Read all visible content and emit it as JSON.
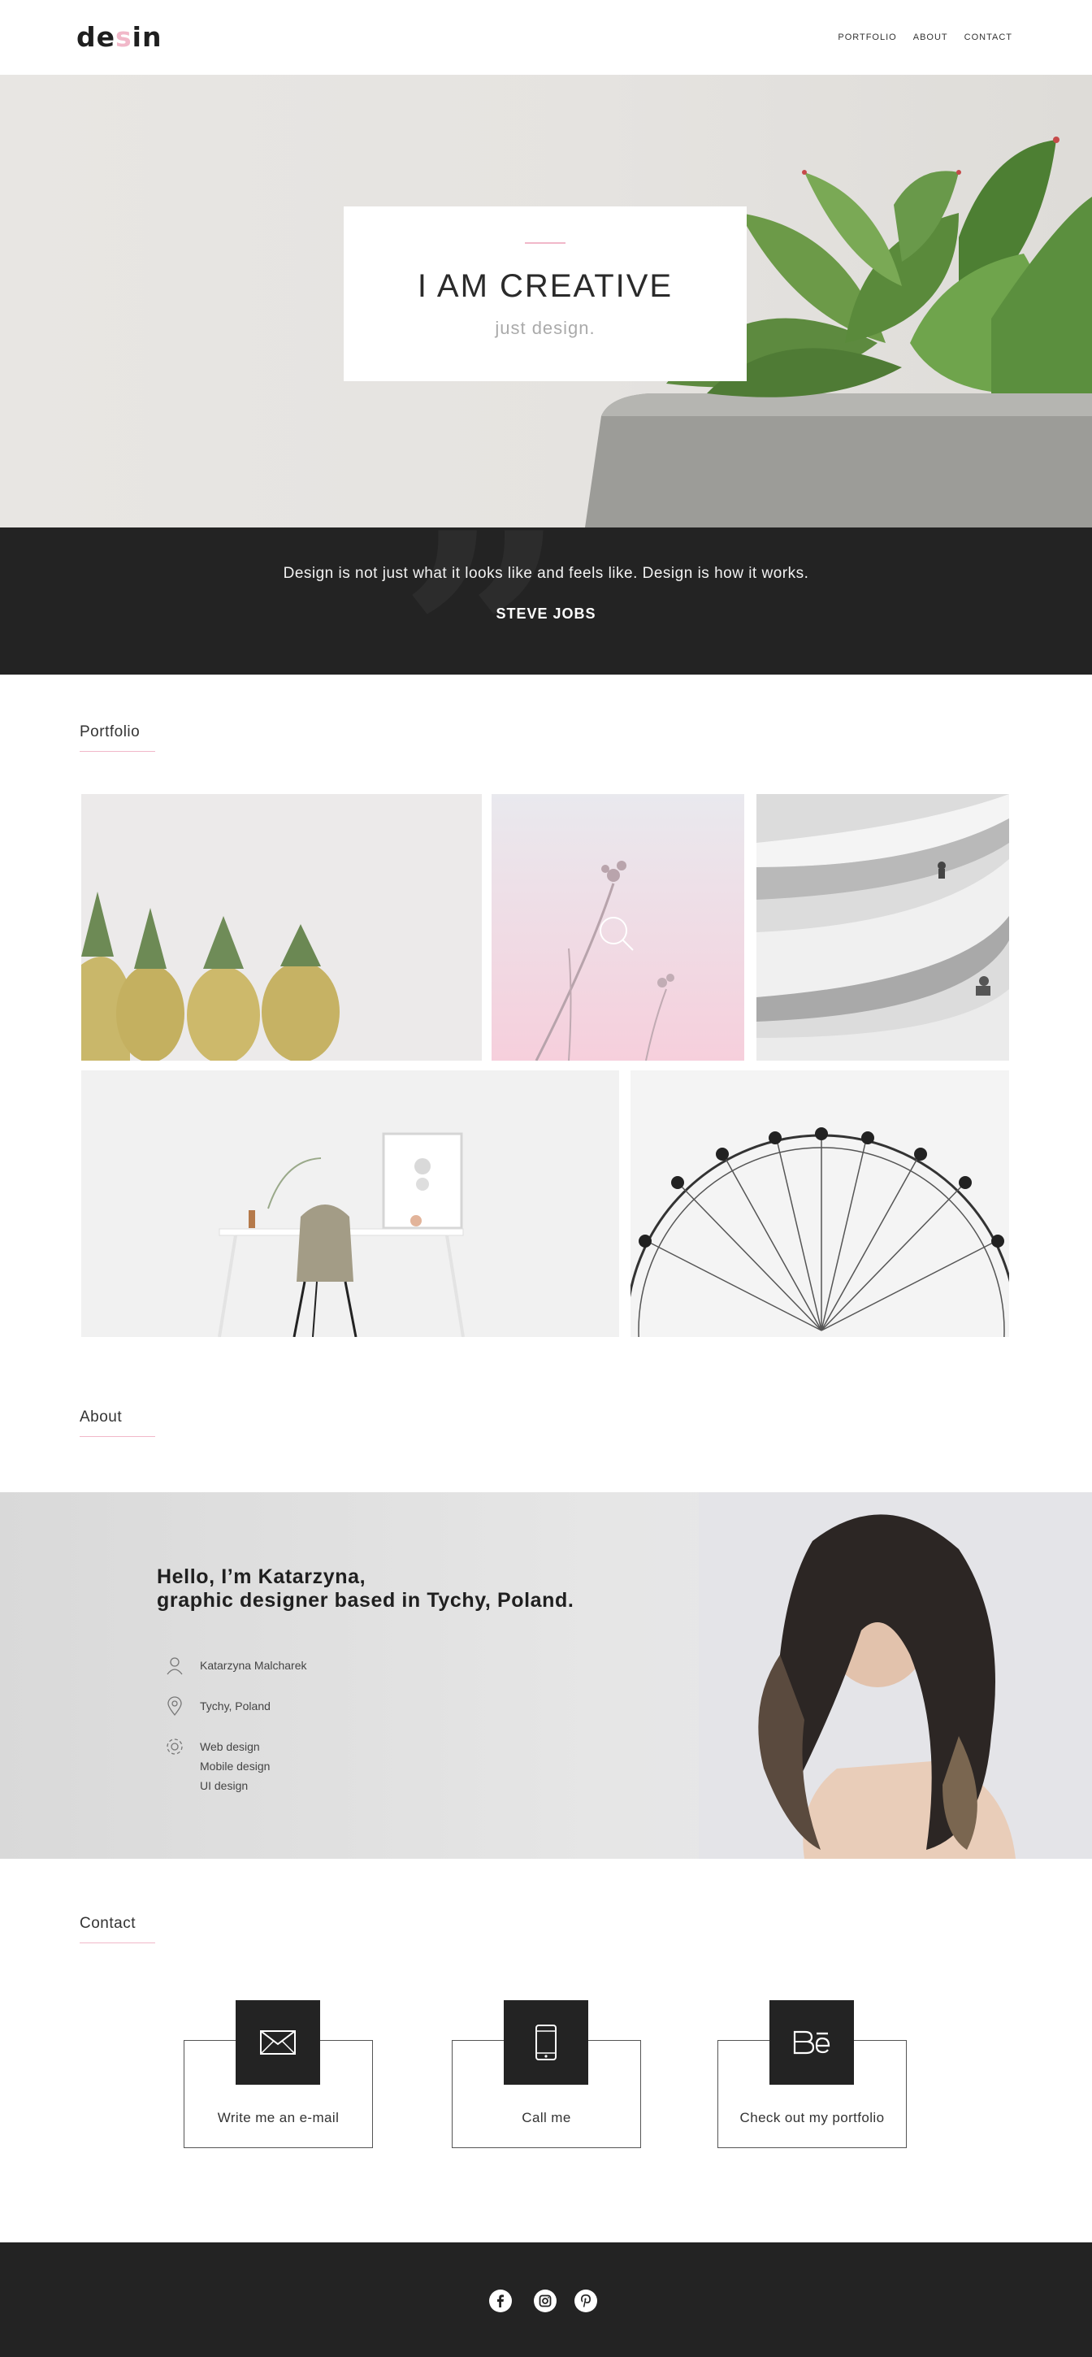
{
  "logo": {
    "before": "de",
    "accent": "s",
    "after": "in"
  },
  "nav": {
    "portfolio": "PORTFOLIO",
    "about": "ABOUT",
    "contact": "CONTACT"
  },
  "hero": {
    "title": "I AM CREATIVE",
    "subtitle": "just design."
  },
  "quote": {
    "text": "Design is not just what it looks like and feels like. Design is how it works.",
    "author": "STEVE JOBS"
  },
  "sections": {
    "portfolio": "Portfolio",
    "about": "About",
    "contact": "Contact"
  },
  "portfolio": {
    "items": [
      "pineapples-photo",
      "pink-flowers-photo",
      "spiral-architecture-photo",
      "desk-chair-photo",
      "ferris-wheel-photo"
    ]
  },
  "about": {
    "heading_line1": "Hello, I’m Katarzyna,",
    "heading_line2": "graphic designer based in Tychy, Poland.",
    "name": "Katarzyna Malcharek",
    "location": "Tychy, Poland",
    "skills": [
      "Web design",
      "Mobile design",
      "UI design"
    ]
  },
  "contact": {
    "email_label": "Write me an e-mail",
    "phone_label": "Call me",
    "portfolio_label": "Check out my portfolio"
  },
  "icons": {
    "email": "envelope-icon",
    "phone": "phone-icon",
    "behance": "behance-icon",
    "facebook": "facebook-icon",
    "instagram": "instagram-icon",
    "pinterest": "pinterest-icon"
  },
  "colors": {
    "accent": "#f1b8c9",
    "dark": "#232323"
  }
}
